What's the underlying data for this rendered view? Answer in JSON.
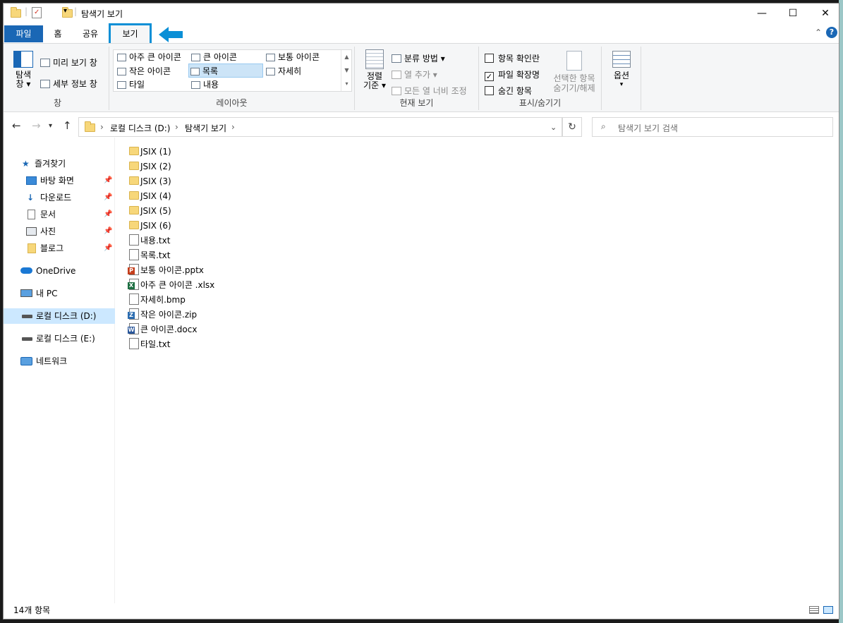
{
  "window": {
    "title": "탐색기 보기",
    "minimize": "—",
    "maximize": "☐",
    "close": "✕"
  },
  "tabs": {
    "file": "파일",
    "home": "홈",
    "share": "공유",
    "view": "보기"
  },
  "ribbon": {
    "pane_group": {
      "navigation_pane": "탐색\n창",
      "navigation_pane_line1": "탐색",
      "navigation_pane_line2": "창",
      "preview_pane": "미리 보기 창",
      "details_pane": "세부 정보 창",
      "label": "창"
    },
    "layout_group": {
      "extra_large": "아주 큰 아이콘",
      "large": "큰 아이콘",
      "medium": "보통 아이콘",
      "small": "작은 아이콘",
      "list": "목록",
      "details": "자세히",
      "tiles": "타일",
      "content": "내용",
      "label": "레이아웃",
      "selected": "목록"
    },
    "current_view_group": {
      "sort_by_line1": "정렬",
      "sort_by_line2": "기준",
      "group_by": "분류 방법",
      "add_columns": "열 추가",
      "size_all_columns": "모든 열 너비 조정",
      "label": "현재 보기"
    },
    "show_hide_group": {
      "item_checkboxes": "항목 확인란",
      "item_checkboxes_checked": false,
      "file_extensions": "파일 확장명",
      "file_extensions_checked": true,
      "hidden_items": "숨긴 항목",
      "hidden_items_checked": false,
      "hide_selected_line1": "선택한 항목",
      "hide_selected_line2": "숨기기/해제",
      "label": "표시/숨기기"
    },
    "options": "옵션"
  },
  "address": {
    "crumb_root": "로컬 디스크 (D:)",
    "crumb_folder": "탐색기 보기",
    "search_placeholder": "탐색기 보기 검색"
  },
  "nav_pane": {
    "quick_access": "즐겨찾기",
    "items": [
      {
        "label": "바탕 화면",
        "icon": "desktop-icon"
      },
      {
        "label": "다운로드",
        "icon": "download-icon"
      },
      {
        "label": "문서",
        "icon": "documents-icon"
      },
      {
        "label": "사진",
        "icon": "pictures-icon"
      },
      {
        "label": "블로그",
        "icon": "folder-icon"
      }
    ],
    "onedrive": "OneDrive",
    "this_pc": "내 PC",
    "drive_d": "로컬 디스크 (D:)",
    "drive_e": "로컬 디스크 (E:)",
    "network": "네트워크"
  },
  "files": [
    {
      "name": "JSIX (1)",
      "type": "folder"
    },
    {
      "name": "JSIX (2)",
      "type": "folder"
    },
    {
      "name": "JSIX (3)",
      "type": "folder"
    },
    {
      "name": "JSIX (4)",
      "type": "folder"
    },
    {
      "name": "JSIX (5)",
      "type": "folder"
    },
    {
      "name": "JSIX (6)",
      "type": "folder"
    },
    {
      "name": "내용.txt",
      "type": "txt"
    },
    {
      "name": "목록.txt",
      "type": "txt"
    },
    {
      "name": "보통 아이콘.pptx",
      "type": "pptx"
    },
    {
      "name": "아주 큰 아이콘 .xlsx",
      "type": "xlsx"
    },
    {
      "name": "자세히.bmp",
      "type": "bmp"
    },
    {
      "name": "작은 아이콘.zip",
      "type": "zip"
    },
    {
      "name": "큰 아이콘.docx",
      "type": "docx"
    },
    {
      "name": "타일.txt",
      "type": "txt"
    }
  ],
  "status": {
    "item_count": "14개 항목"
  },
  "colors": {
    "file_tab": "#1a67b5",
    "highlight_border": "#0b8fd6",
    "arrow": "#0b8fd6",
    "selection": "#cce8ff",
    "folder": "#f7d77a"
  }
}
